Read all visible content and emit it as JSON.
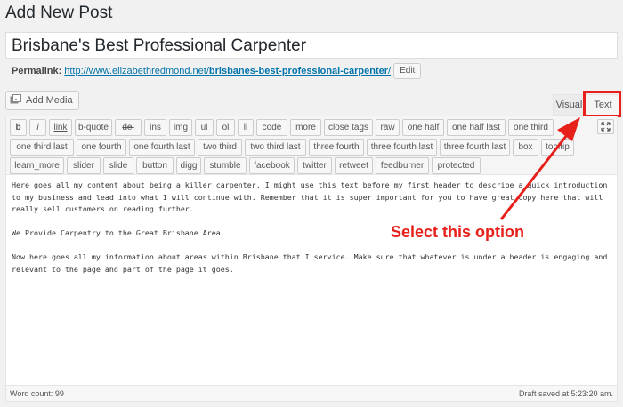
{
  "page_title": "Add New Post",
  "post_title": "Brisbane's Best Professional Carpenter",
  "permalink": {
    "label": "Permalink:",
    "base": "http://www.elizabethredmond.net/",
    "slug": "brisbanes-best-professional-carpenter",
    "trailing": "/",
    "edit_label": "Edit"
  },
  "add_media_label": "Add Media",
  "editor_tabs": {
    "visual": "Visual",
    "text": "Text"
  },
  "quicktags": [
    [
      "b",
      "i",
      "link",
      "b-quote",
      "del",
      "ins",
      "img",
      "ul",
      "ol",
      "li",
      "code",
      "more",
      "close tags",
      "raw",
      "one half",
      "one half last",
      "one third"
    ],
    [
      "one third last",
      "one fourth",
      "one fourth last",
      "two third",
      "two third last",
      "three fourth",
      "three fourth last",
      "three fourth last",
      "box",
      "tooltip"
    ],
    [
      "learn_more",
      "slider",
      "slide",
      "button",
      "digg",
      "stumble",
      "facebook",
      "twitter",
      "retweet",
      "feedburner",
      "protected"
    ]
  ],
  "content": {
    "p1": "Here goes all my content about being a killer carpenter. I might use this text before my first header to describe a quick introduction to my business and lead into what I will continue with. Remember that it is super important for you to have great copy here that will really sell customers on reading further.",
    "p2": "We Provide Carpentry to the Great Brisbane Area",
    "p3": "Now here goes all my information about areas within Brisbane that I service. Make sure that whatever is under a header is engaging and relevant to the page and part of the page it goes."
  },
  "status": {
    "word_count": "Word count: 99",
    "draft_saved": "Draft saved at 5:23:20 am."
  },
  "annotation": "Select this option",
  "colors": {
    "annotation": "#e8201c",
    "link": "#0073aa"
  }
}
